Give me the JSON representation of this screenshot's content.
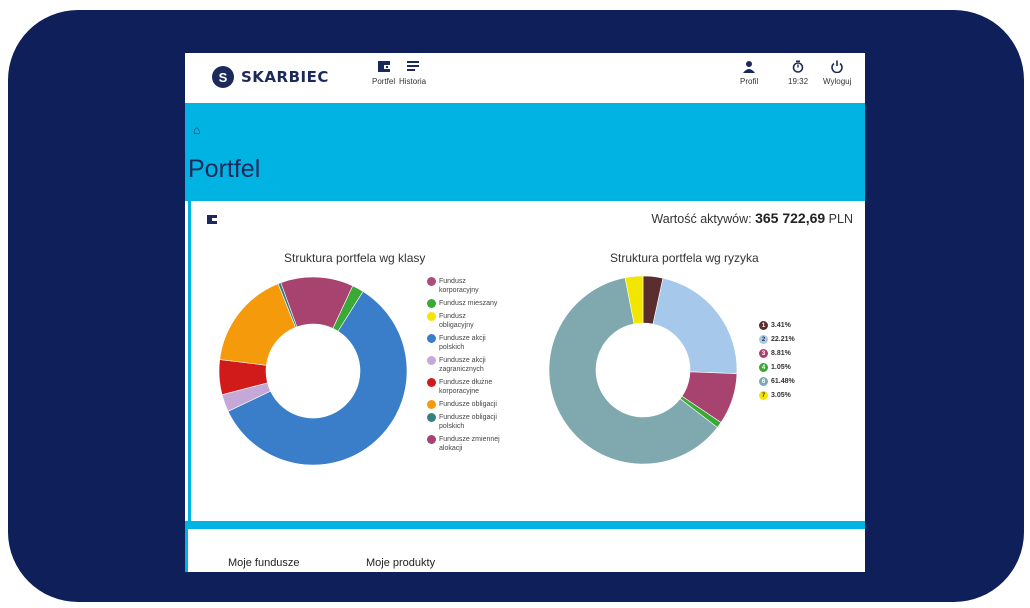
{
  "header": {
    "logo_letter": "S",
    "logo_text": "SKARBIEC",
    "nav_portfel": "Portfel",
    "nav_historia": "Historia",
    "profil": "Profil",
    "timer": "19:32",
    "wyloguj": "Wyloguj"
  },
  "hero": {
    "breadcrumb": "⌂",
    "title": "Portfel"
  },
  "summary": {
    "label": "Wartość aktywów:",
    "amount": "365 722,69",
    "currency": "PLN"
  },
  "colors": {
    "accent": "#00b3e3",
    "frame": "#0e1f5a",
    "brand": "#1b2a5b"
  },
  "chart_data": [
    {
      "type": "pie",
      "title": "Struktura portfela wg klasy",
      "series": [
        {
          "name": "Fundusz korporacyjny",
          "value": 0,
          "color": "#b04a7a"
        },
        {
          "name": "Fundusz mieszany",
          "value": 2,
          "color": "#3aa935"
        },
        {
          "name": "Fundusz obligacyjny",
          "value": 0,
          "color": "#f2e600"
        },
        {
          "name": "Fundusze akcji polskich",
          "value": 59,
          "color": "#3a7ec9"
        },
        {
          "name": "Fundusze akcji zagranicznych",
          "value": 3,
          "color": "#c4a8d8"
        },
        {
          "name": "Fundusze dłużne korporacyjne",
          "value": 6,
          "color": "#d11a1a"
        },
        {
          "name": "Fundusze obligacji",
          "value": 17,
          "color": "#f59a0a"
        },
        {
          "name": "Fundusze obligacji polskich",
          "value": 0.5,
          "color": "#3a7e85"
        },
        {
          "name": "Fundusze zmiennej alokacji",
          "value": 12.5,
          "color": "#a8426f"
        }
      ],
      "legend_labels": [
        [
          "Fundusz",
          "korporacyjny"
        ],
        [
          "Fundusz mieszany"
        ],
        [
          "Fundusz",
          "obligacyjny"
        ],
        [
          "Fundusze akcji",
          "polskich"
        ],
        [
          "Fundusze akcji",
          "zagranicznych"
        ],
        [
          "Fundusze dłużne",
          "korporacyjne"
        ],
        [
          "Fundusze obligacji"
        ],
        [
          "Fundusze obligacji",
          "polskich"
        ],
        [
          "Fundusze zmiennej",
          "alokacji"
        ]
      ],
      "legend": "right"
    },
    {
      "type": "pie",
      "title": "Struktura portfela wg ryzyka",
      "series": [
        {
          "name": "1",
          "label": "3.41%",
          "value": 3.41,
          "color": "#5a2e2e"
        },
        {
          "name": "2",
          "label": "22.21%",
          "value": 22.21,
          "color": "#a6c8ea"
        },
        {
          "name": "3",
          "label": "8.81%",
          "value": 8.81,
          "color": "#a8426f"
        },
        {
          "name": "4",
          "label": "1.05%",
          "value": 1.05,
          "color": "#3aa935"
        },
        {
          "name": "6",
          "label": "61.48%",
          "value": 61.48,
          "color": "#7fa9ae"
        },
        {
          "name": "7",
          "label": "3.05%",
          "value": 3.05,
          "color": "#f2e600"
        }
      ],
      "legend": "right"
    }
  ],
  "tabs": {
    "moje_fundusze": "Moje fundusze",
    "moje_produkty": "Moje produkty"
  }
}
